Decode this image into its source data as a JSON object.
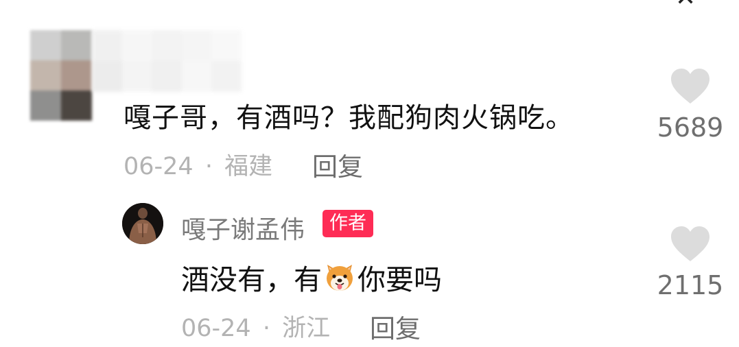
{
  "top_icon": "close-icon",
  "comment": {
    "text": "嘎子哥，有酒吗？我配狗肉火锅吃。",
    "date": "06-24",
    "separator": "·",
    "location": "福建",
    "reply_label": "回复",
    "likes": "5689",
    "like_icon": "heart-icon",
    "avatar_mosaic_colors": [
      "#cfcfcf",
      "#b9b9b7",
      "#c3b6ac",
      "#ad978c",
      "#8f8f8e",
      "#4c4641"
    ],
    "name_mosaic_colors": [
      "#ececec",
      "#f4f4f4",
      "#efefef",
      "#f2f2f2",
      "#f6f6f6",
      "#e6e6e6",
      "#f1f1f1",
      "#ebebeb",
      "#f5f5f5",
      "#eeeeee"
    ]
  },
  "reply": {
    "author_name": "嘎子谢孟伟",
    "author_badge": "作者",
    "text_before": "酒没有，有",
    "emoji": "dog-face-emoji",
    "text_after": "你要吗",
    "date": "06-24",
    "separator": "·",
    "location": "浙江",
    "reply_label": "回复",
    "likes": "2115",
    "like_icon": "heart-icon"
  },
  "colors": {
    "badge": "#fe2c55",
    "heart": "#dcdcdc",
    "text": "#111111",
    "meta": "#b3b3b3"
  }
}
